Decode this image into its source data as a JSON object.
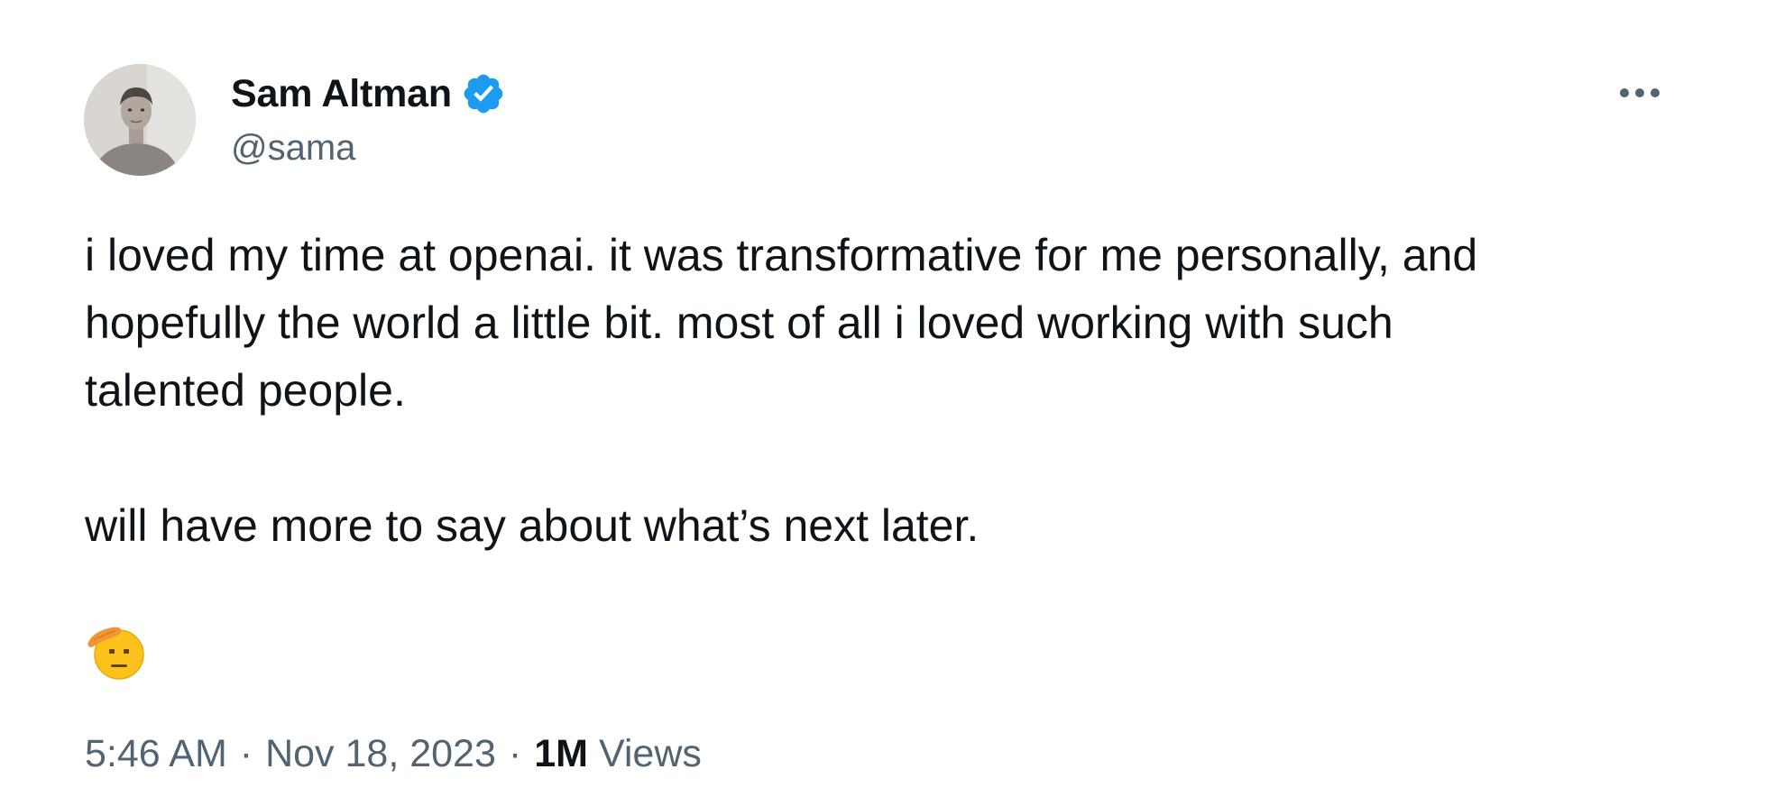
{
  "author": {
    "display_name": "Sam Altman",
    "handle": "@sama",
    "verified": true,
    "verified_color": "#1d9bf0",
    "avatar_icon": "profile-photo"
  },
  "menu": {
    "icon": "more-horizontal-icon"
  },
  "tweet": {
    "text": "i loved my time at openai. it was transformative for me personally, and\nhopefully the world a little bit. most of all i loved working with such\ntalented people.\n\nwill have more to say about what’s next later.",
    "emoji": "saluting-face-emoji"
  },
  "meta": {
    "time": "5:46 AM",
    "separator": "·",
    "date": "Nov 18, 2023",
    "views_count": "1M",
    "views_label": "Views"
  },
  "colors": {
    "text_primary": "#0f1419",
    "text_secondary": "#536471",
    "accent": "#1d9bf0"
  }
}
